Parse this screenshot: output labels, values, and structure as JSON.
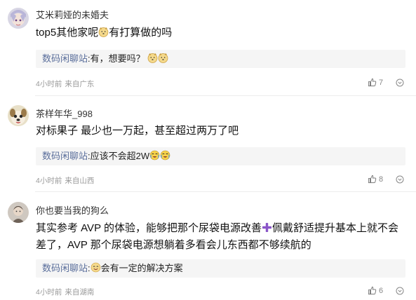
{
  "comments": [
    {
      "username": "艾米莉娅的未婚夫",
      "text_before": "top5其他家呢",
      "text_after": "有打算做的吗",
      "reply": {
        "user": "数码闲聊站",
        "text": ":有，想要吗？"
      },
      "meta": {
        "time": "4小时前",
        "location": "来自广东"
      },
      "likes": "7"
    },
    {
      "username": "茶样年华_998",
      "text": "对标果子 最少也一万起，甚至超过两万了吧",
      "reply": {
        "user": "数码闲聊站",
        "text": ":应该不会超2W"
      },
      "meta": {
        "time": "4小时前",
        "location": "来自山西"
      },
      "likes": "8"
    },
    {
      "username": "你也要当我的狗么",
      "text_before": "其实参考 AVP 的体验，能够把那个尿袋电源改善",
      "text_after": "佩戴舒适提升基本上就不会差了，AVP 那个尿袋电源想躺着多看会儿东西都不够续航的",
      "reply": {
        "user": "数码闲聊站",
        "text": "会有一定的解决方案"
      },
      "meta": {
        "time": "4小时前",
        "location": "来自湖南"
      },
      "likes": "6"
    }
  ],
  "colors": {
    "reply_user": "#5a6e9b",
    "reply_bg": "#f5f5f5",
    "meta": "#999999",
    "plus": "#8a55c8"
  },
  "icons": [
    "avatar-anime",
    "avatar-dog",
    "avatar-character",
    "thumbs-up-icon",
    "more-chevron-icon",
    "emoji-doge",
    "emoji-cry-laugh",
    "emoji-smile",
    "plus-icon"
  ]
}
